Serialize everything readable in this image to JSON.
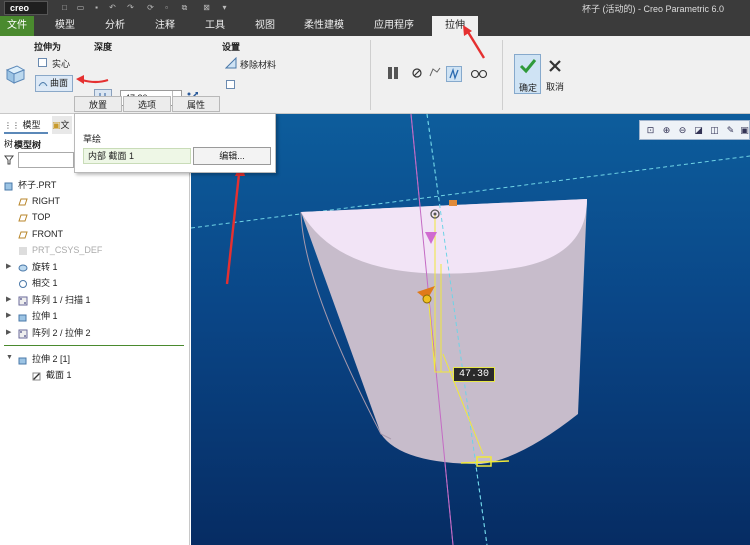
{
  "app": {
    "logo": "creo",
    "window_title": "杯子 (活动的) - Creo Parametric 6.0"
  },
  "menu": {
    "tabs": [
      "文件",
      "模型",
      "分析",
      "注释",
      "工具",
      "视图",
      "柔性建模",
      "应用程序",
      "拉伸"
    ]
  },
  "ribbon": {
    "extrude_as_label": "拉伸为",
    "solid_label": "实心",
    "surface_label": "曲面",
    "depth_label": "深度",
    "depth_value": "47.30",
    "settings_label": "设置",
    "remove_material_label": "移除材料",
    "ok_label": "确定",
    "cancel_label": "取消",
    "subtabs": [
      "放置",
      "选项",
      "属性"
    ]
  },
  "popup": {
    "sketch_label": "草绘",
    "sketch_value": "内部 截面 1",
    "edit_button": "编辑..."
  },
  "left_panel": {
    "tab_model_tree": "模型树",
    "tab_other": "文",
    "header": "模型树",
    "items": [
      {
        "label": "杯子.PRT",
        "icon": "part-icon"
      },
      {
        "label": "RIGHT",
        "icon": "datum-plane-icon"
      },
      {
        "label": "TOP",
        "icon": "datum-plane-icon"
      },
      {
        "label": "FRONT",
        "icon": "datum-plane-icon"
      },
      {
        "label": "PRT_CSYS_DEF",
        "icon": "csys-icon"
      },
      {
        "label": "旋转 1",
        "icon": "revolve-icon"
      },
      {
        "label": "相交 1",
        "icon": "intersect-icon"
      },
      {
        "label": "阵列 1 / 扫描 1",
        "icon": "pattern-icon"
      },
      {
        "label": "拉伸 1",
        "icon": "extrude-icon"
      },
      {
        "label": "阵列 2 / 拉伸 2",
        "icon": "pattern-icon"
      },
      {
        "label": "拉伸 2 [1]",
        "icon": "extrude-icon"
      },
      {
        "label": "截面 1",
        "icon": "sketch-icon"
      }
    ]
  },
  "viewport": {
    "dimension_value": "47.30"
  },
  "colors": {
    "file_tab": "#4a8a2e",
    "annotation_arrow": "#e53030",
    "model_top": "#f2e4f6",
    "model_side": "#c7bccb",
    "viewport_bg": "#0a4687"
  }
}
